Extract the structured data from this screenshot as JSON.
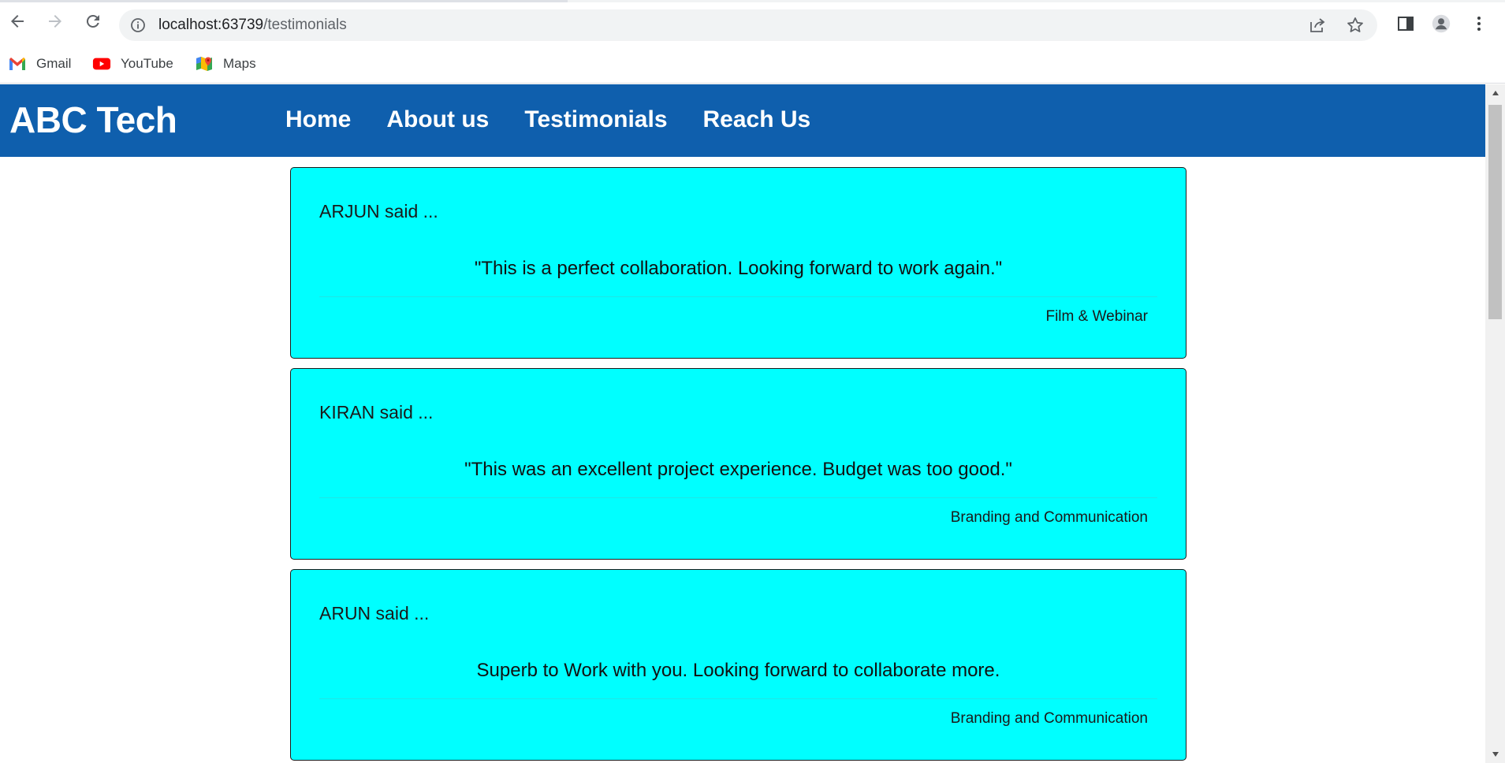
{
  "browser": {
    "url_host": "localhost:63739",
    "url_path": "/testimonials",
    "bookmarks": [
      {
        "label": "Gmail",
        "icon": "gmail-icon"
      },
      {
        "label": "YouTube",
        "icon": "youtube-icon"
      },
      {
        "label": "Maps",
        "icon": "maps-icon"
      }
    ]
  },
  "site": {
    "brand": "ABC Tech",
    "menu": [
      "Home",
      "About us",
      "Testimonials",
      "Reach Us"
    ]
  },
  "testimonials": [
    {
      "who": "ARJUN said ...",
      "quote": "\"This is a perfect collaboration. Looking forward to work again.\"",
      "category": "Film & Webinar"
    },
    {
      "who": "KIRAN said ...",
      "quote": "\"This was an excellent project experience. Budget was too good.\"",
      "category": "Branding and Communication"
    },
    {
      "who": "ARUN said ...",
      "quote": "Superb to Work with you. Looking forward to collaborate more.",
      "category": "Branding and Communication"
    }
  ],
  "colors": {
    "navbar": "#0f5fad",
    "card": "#00ffff"
  }
}
